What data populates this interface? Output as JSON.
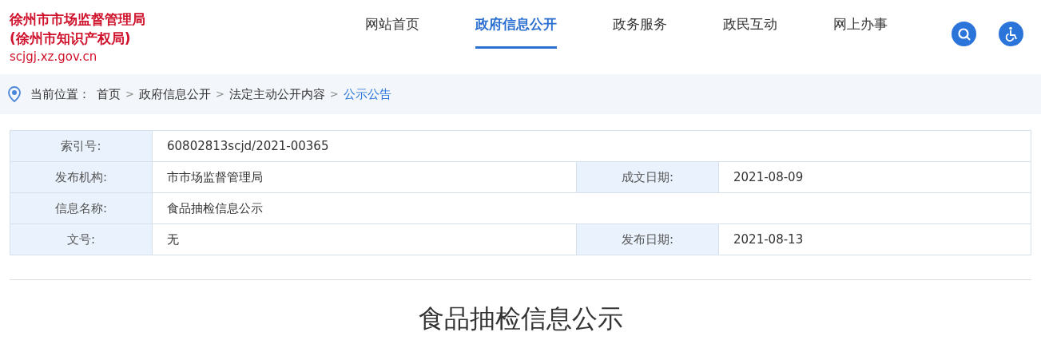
{
  "site": {
    "title_line_1": "徐州市市场监督管理局",
    "title_line_2": "(徐州市知识产权局)",
    "domain": "scjgj.xz.gov.cn"
  },
  "nav": [
    {
      "label": "网站首页",
      "selected": false
    },
    {
      "label": "政府信息公开",
      "selected": true
    },
    {
      "label": "政务服务",
      "selected": false
    },
    {
      "label": "政民互动",
      "selected": false
    },
    {
      "label": "网上办事",
      "selected": false
    }
  ],
  "breadcrumb": {
    "label": "当前位置：",
    "items": [
      {
        "text": "首页",
        "current": false
      },
      {
        "separator": ">",
        "text": "政府信息公开",
        "current": false
      },
      {
        "separator": ">",
        "text": "法定主动公开内容",
        "current": false
      },
      {
        "separator": ">",
        "text": "公示公告",
        "current": true
      }
    ]
  },
  "info_table": [
    [
      {
        "label": "索引号:",
        "value": "60802813scjd/2021-00365"
      }
    ],
    [
      {
        "label": "发布机构:",
        "value": "市市场监督管理局"
      },
      {
        "label": "成文日期:",
        "value": "2021-08-09"
      }
    ],
    [
      {
        "label": "信息名称:",
        "value": "食品抽检信息公示"
      }
    ],
    [
      {
        "label": "文号:",
        "value": "无"
      },
      {
        "label": "发布日期:",
        "value": "2021-08-13"
      }
    ]
  ],
  "article": {
    "title": "食品抽检信息公示"
  }
}
